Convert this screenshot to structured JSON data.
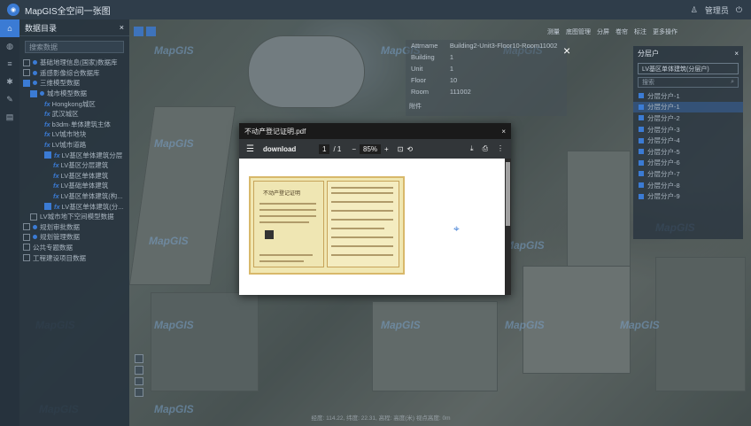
{
  "app": {
    "title": "MapGIS全空间一张图",
    "user": "管理员"
  },
  "rail": {
    "items": [
      "home-icon",
      "globe-icon",
      "layers-icon",
      "settings-icon",
      "ruler-icon",
      "db-icon"
    ]
  },
  "sidebar": {
    "title": "数据目录",
    "close": "×",
    "search_placeholder": "搜索数据",
    "items": [
      "基础地理信息(国家)数据库",
      "遥感影像综合数据库",
      "三维模型数据",
      "城市模型数据",
      "Hongkong城区",
      "武汉城区",
      "b3dm·单体建筑主体",
      "LV城市地块",
      "LV城市道路",
      "LV基区单体建筑分层",
      "LV基区分层建筑",
      "LV基区单体建筑",
      "LV基础单体建筑",
      "LV基区单体建筑(构...",
      "LV基区单体建筑(分...",
      "LV城市地下空间模型数据",
      "规划审批数据",
      "规划管理数据",
      "公共专题数据",
      "工程建设项目数据"
    ]
  },
  "toolbar": {
    "items": [
      "测量",
      "底图管理",
      "分屏",
      "卷帘",
      "标注",
      "更多操作"
    ]
  },
  "attribute": {
    "rows": [
      {
        "k": "Attrname",
        "v": "Building2-Unit3-Floor10-Room11002"
      },
      {
        "k": "Building",
        "v": "1"
      },
      {
        "k": "Unit",
        "v": "1"
      },
      {
        "k": "Floor",
        "v": "10"
      },
      {
        "k": "Room",
        "v": "111002"
      }
    ],
    "sub": "附件",
    "close": "×"
  },
  "right_panel": {
    "title": "分层户",
    "select": "LV基区单体建筑(分层户)",
    "search_placeholder": "搜索",
    "items": [
      "分层分户-1",
      "分层分户-1",
      "分层分户-2",
      "分层分户-3",
      "分层分户-4",
      "分层分户-5",
      "分层分户-6",
      "分层分户-7",
      "分层分户-8",
      "分层分户-9"
    ]
  },
  "pdf": {
    "filename": "不动产登记证明.pdf",
    "name": "download",
    "page": "1",
    "of": "/ 1",
    "zoom": "85%",
    "cert_title": "不动产登记证明"
  },
  "watermark": "MapGIS",
  "status": "经度: 114.22, 纬度: 22.31, 高程: 高度(米) 视点高度: 0m"
}
